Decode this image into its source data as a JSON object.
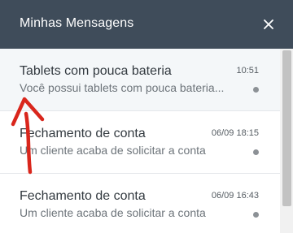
{
  "header": {
    "title": "Minhas Mensagens",
    "close_icon": "close-icon"
  },
  "messages": [
    {
      "title": "Tablets com pouca bateria",
      "preview": "Você possui tablets com pouca bateria...",
      "time": "10:51",
      "selected": true,
      "unread": true
    },
    {
      "title": "Fechamento de conta",
      "preview": "Um cliente acaba de solicitar a conta",
      "time": "06/09 18:15",
      "selected": false,
      "unread": true
    },
    {
      "title": "Fechamento de conta",
      "preview": "Um cliente acaba de solicitar a conta",
      "time": "06/09 16:43",
      "selected": false,
      "unread": true
    }
  ],
  "annotation": {
    "icon": "curved-arrow-icon",
    "color": "#d9261c"
  },
  "colors": {
    "header_bg": "#3f4c5a",
    "selected_bg": "#f4f7f9",
    "unread_dot": "#8c9196"
  }
}
